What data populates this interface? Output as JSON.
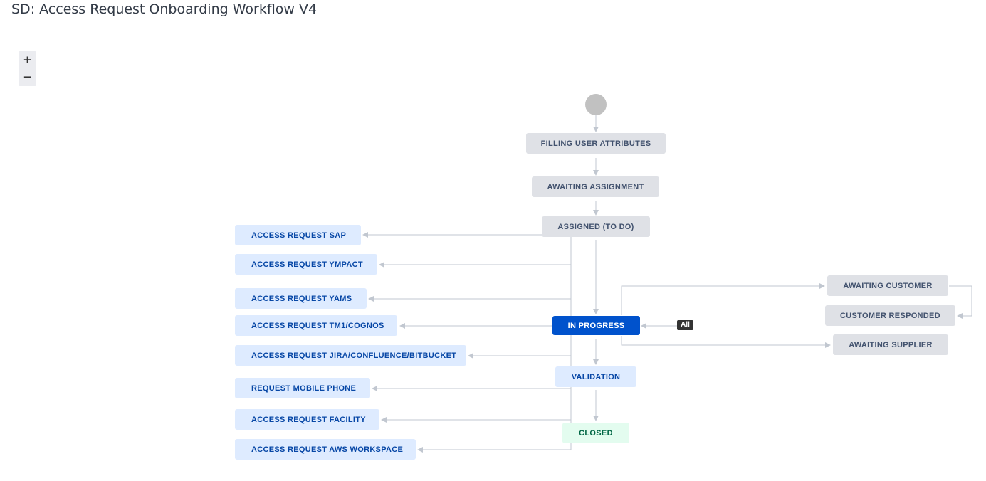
{
  "page": {
    "title": "SD: Access Request Onboarding Workflow V4"
  },
  "zoom": {
    "in_label": "+",
    "out_label": "−"
  },
  "statuses": {
    "filling_user_attributes": "FILLING USER ATTRIBUTES",
    "awaiting_assignment": "AWAITING ASSIGNMENT",
    "assigned_to_do": "ASSIGNED (TO DO)",
    "in_progress": "IN PROGRESS",
    "validation": "VALIDATION",
    "closed": "CLOSED",
    "awaiting_customer": "AWAITING CUSTOMER",
    "customer_responded": "CUSTOMER RESPONDED",
    "awaiting_supplier": "AWAITING SUPPLIER",
    "access_request_sap": "ACCESS REQUEST SAP",
    "access_request_ympact": "ACCESS REQUEST YMPACT",
    "access_request_yams": "ACCESS REQUEST YAMS",
    "access_request_tm1_cognos": "ACCESS REQUEST TM1/COGNOS",
    "access_request_jira": "ACCESS REQUEST JIRA/CONFLUENCE/BITBUCKET",
    "request_mobile_phone": "REQUEST MOBILE PHONE",
    "access_request_facility": "ACCESS REQUEST FACILITY",
    "access_request_aws": "ACCESS REQUEST AWS WORKSPACE"
  },
  "global_transition": {
    "label": "All"
  },
  "colors": {
    "todo_bg": "#dfe1e6",
    "in_progress_bg": "#deebff",
    "done_bg": "#e3fcef",
    "selected_bg": "#0052cc",
    "edge": "#c1c7d0"
  }
}
